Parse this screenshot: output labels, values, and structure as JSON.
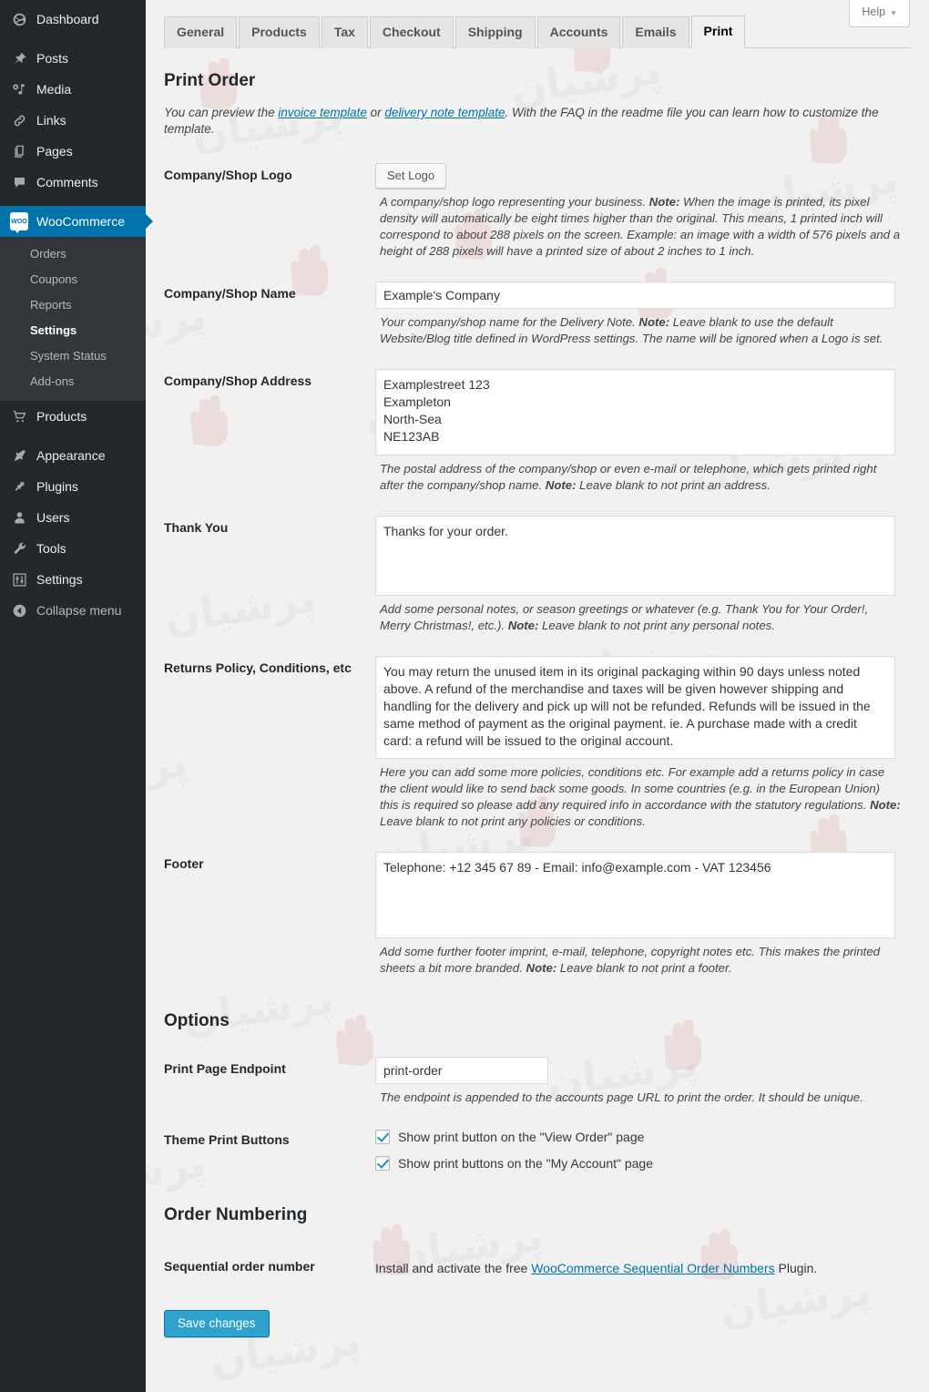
{
  "sidebar": {
    "items": [
      {
        "label": "Dashboard",
        "icon": "dashboard-icon",
        "name": "dashboard"
      },
      {
        "label": "Posts",
        "icon": "pin-icon",
        "name": "posts"
      },
      {
        "label": "Media",
        "icon": "media-icon",
        "name": "media"
      },
      {
        "label": "Links",
        "icon": "link-icon",
        "name": "links"
      },
      {
        "label": "Pages",
        "icon": "pages-icon",
        "name": "pages"
      },
      {
        "label": "Comments",
        "icon": "comment-icon",
        "name": "comments"
      },
      {
        "label": "WooCommerce",
        "icon": "woocommerce-icon",
        "name": "woocommerce",
        "active": true
      },
      {
        "label": "Products",
        "icon": "cart-icon",
        "name": "products"
      },
      {
        "label": "Appearance",
        "icon": "brush-icon",
        "name": "appearance"
      },
      {
        "label": "Plugins",
        "icon": "plug-icon",
        "name": "plugins"
      },
      {
        "label": "Users",
        "icon": "user-icon",
        "name": "users"
      },
      {
        "label": "Tools",
        "icon": "wrench-icon",
        "name": "tools"
      },
      {
        "label": "Settings",
        "icon": "sliders-icon",
        "name": "settings"
      },
      {
        "label": "Collapse menu",
        "icon": "collapse-icon",
        "name": "collapse-menu"
      }
    ],
    "submenu": [
      {
        "label": "Orders",
        "current": false
      },
      {
        "label": "Coupons",
        "current": false
      },
      {
        "label": "Reports",
        "current": false
      },
      {
        "label": "Settings",
        "current": true
      },
      {
        "label": "System Status",
        "current": false
      },
      {
        "label": "Add-ons",
        "current": false
      }
    ]
  },
  "header": {
    "help_label": "Help",
    "help_caret": "▼"
  },
  "tabs": [
    {
      "label": "General",
      "active": false
    },
    {
      "label": "Products",
      "active": false
    },
    {
      "label": "Tax",
      "active": false
    },
    {
      "label": "Checkout",
      "active": false
    },
    {
      "label": "Shipping",
      "active": false
    },
    {
      "label": "Accounts",
      "active": false
    },
    {
      "label": "Emails",
      "active": false
    },
    {
      "label": "Print",
      "active": true
    }
  ],
  "print_order": {
    "heading": "Print Order",
    "intro_pre": "You can preview the ",
    "intro_link1": "invoice template",
    "intro_mid": " or ",
    "intro_link2": "delivery note template",
    "intro_post": ". With the FAQ in the readme file you can learn how to customize the template."
  },
  "fields": {
    "logo": {
      "label": "Company/Shop Logo",
      "button": "Set Logo",
      "desc_a": "A company/shop logo representing your business. ",
      "desc_note": "Note:",
      "desc_b": " When the image is printed, its pixel density will automatically be eight times higher than the original. This means, 1 printed inch will correspond to about 288 pixels on the screen. Example: an image with a width of 576 pixels and a height of 288 pixels will have a printed size of about 2 inches to 1 inch."
    },
    "name": {
      "label": "Company/Shop Name",
      "value": "Example's Company",
      "desc_a": "Your company/shop name for the Delivery Note. ",
      "desc_note": "Note:",
      "desc_b": " Leave blank to use the default Website/Blog title defined in WordPress settings. The name will be ignored when a Logo is set."
    },
    "address": {
      "label": "Company/Shop Address",
      "value": "Examplestreet 123\nExampleton\nNorth-Sea\nNE123AB",
      "desc_a": "The postal address of the company/shop or even e-mail or telephone, which gets printed right after the company/shop name. ",
      "desc_note": "Note:",
      "desc_b": " Leave blank to not print an address."
    },
    "thank_you": {
      "label": "Thank You",
      "value": "Thanks for your order.",
      "desc_a": "Add some personal notes, or season greetings or whatever (e.g. Thank You for Your Order!, Merry Christmas!, etc.). ",
      "desc_note": "Note:",
      "desc_b": " Leave blank to not print any personal notes."
    },
    "returns": {
      "label": "Returns Policy, Conditions, etc",
      "value": "You may return the unused item in its original packaging within 90 days unless noted above. A refund of the merchandise and taxes will be given however shipping and handling for the delivery and pick up will not be refunded. Refunds will be issued in the same method of payment as the original payment. ie. A purchase made with a credit card: a refund will be issued to the original account.",
      "desc_a": "Here you can add some more policies, conditions etc. For example add a returns policy in case the client would like to send back some goods. In some countries (e.g. in the European Union) this is required so please add any required info in accordance with the statutory regulations. ",
      "desc_note": "Note:",
      "desc_b": " Leave blank to not print any policies or conditions."
    },
    "footer": {
      "label": "Footer",
      "value": "Telephone: +12 345 67 89 - Email: info@example.com - VAT 123456",
      "desc_a": "Add some further footer imprint, e-mail, telephone, copyright notes etc. This makes the printed sheets a bit more branded. ",
      "desc_note": "Note:",
      "desc_b": " Leave blank to not print a footer."
    }
  },
  "options": {
    "heading": "Options",
    "endpoint": {
      "label": "Print Page Endpoint",
      "value": "print-order",
      "desc": "The endpoint is appended to the accounts page URL to print the order. It should be unique."
    },
    "theme_buttons": {
      "label": "Theme Print Buttons",
      "checkbox1": "Show print button on the \"View Order\" page",
      "checkbox1_checked": true,
      "checkbox2": "Show print buttons on the \"My Account\" page",
      "checkbox2_checked": true
    }
  },
  "order_numbering": {
    "heading": "Order Numbering",
    "label": "Sequential order number",
    "text_pre": "Install and activate the free ",
    "link": "WooCommerce Sequential Order Numbers",
    "text_post": " Plugin."
  },
  "save": {
    "label": "Save changes"
  },
  "colors": {
    "sidebar_bg": "#23282d",
    "submenu_bg": "#32373c",
    "accent_blue": "#0073aa",
    "primary_button": "#2ea2cc",
    "page_bg": "#f1f1f1",
    "link": "#0073aa"
  }
}
